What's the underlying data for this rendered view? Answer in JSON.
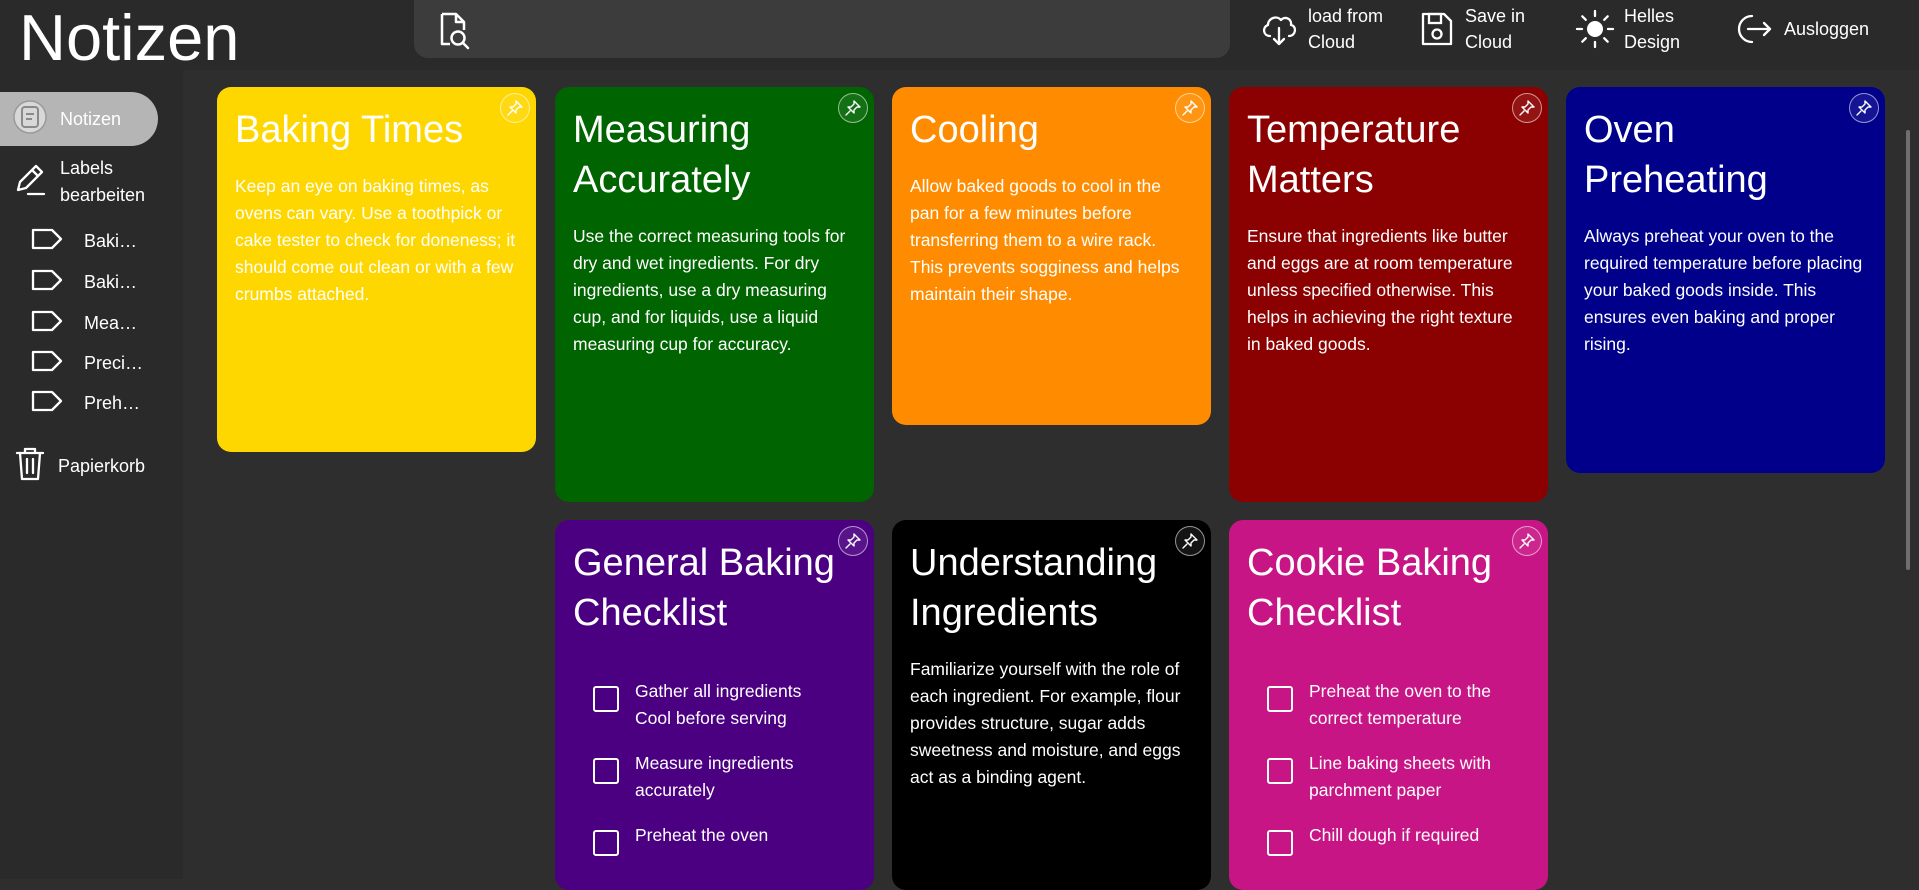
{
  "app": {
    "title": "Notizen"
  },
  "header": {
    "search_icon": "search-document-icon",
    "actions": [
      {
        "label": "load from\nCloud",
        "icon": "cloud-download-icon"
      },
      {
        "label": "Save in\nCloud",
        "icon": "save-icon"
      },
      {
        "label": "Helles\nDesign",
        "icon": "sun-icon"
      },
      {
        "label": "Ausloggen",
        "icon": "logout-icon"
      }
    ]
  },
  "sidebar": {
    "notes_label": "Notizen",
    "edit_labels_label": "Labels\nbearbeiten",
    "labels": [
      {
        "text": "Baki…"
      },
      {
        "text": "Baki…"
      },
      {
        "text": "Meas…"
      },
      {
        "text": "Preci…"
      },
      {
        "text": "Preh…"
      }
    ],
    "trash_label": "Papierkorb"
  },
  "notes": [
    {
      "title": "Baking Times",
      "body": "Keep an eye on baking times, as ovens can vary. Use a toothpick or cake tester to check for doneness; it should come out clean or with a few crumbs attached.",
      "color": "#ffd700"
    },
    {
      "title": "Measuring Accurately",
      "body": "Use the correct measuring tools for dry and wet ingredients. For dry ingredients, use a dry measuring cup, and for liquids, use a liquid measuring cup for accuracy.",
      "color": "#006400"
    },
    {
      "title": "Cooling",
      "body": "Allow baked goods to cool in the pan for a few minutes before transferring them to a wire rack. This prevents sogginess and helps maintain their shape.",
      "color": "#ff8c00"
    },
    {
      "title": "Temperature Matters",
      "body": "Ensure that ingredients like butter and eggs are at room temperature unless specified otherwise. This helps in achieving the right texture in baked goods.",
      "color": "#8b0000"
    },
    {
      "title": "Oven Preheating",
      "body": "Always preheat your oven to the required temperature before placing your baked goods inside. This ensures even baking and proper rising.",
      "color": "#00008b"
    },
    {
      "title": "General Baking Checklist",
      "color": "#4b0082",
      "checklist": [
        "Gather all ingredients\nCool before serving",
        "Measure ingredients\naccurately",
        "Preheat the oven"
      ]
    },
    {
      "title": "Understanding Ingredients",
      "body": "Familiarize yourself with the role of each ingredient. For example, flour provides structure, sugar adds sweetness and moisture, and eggs act as a binding agent.",
      "color": "#000000"
    },
    {
      "title": "Cookie Baking Checklist",
      "color": "#c71585",
      "checklist": [
        "Preheat the oven to the\ncorrect temperature",
        "Line baking sheets with\nparchment paper",
        "Chill dough if required"
      ]
    }
  ]
}
